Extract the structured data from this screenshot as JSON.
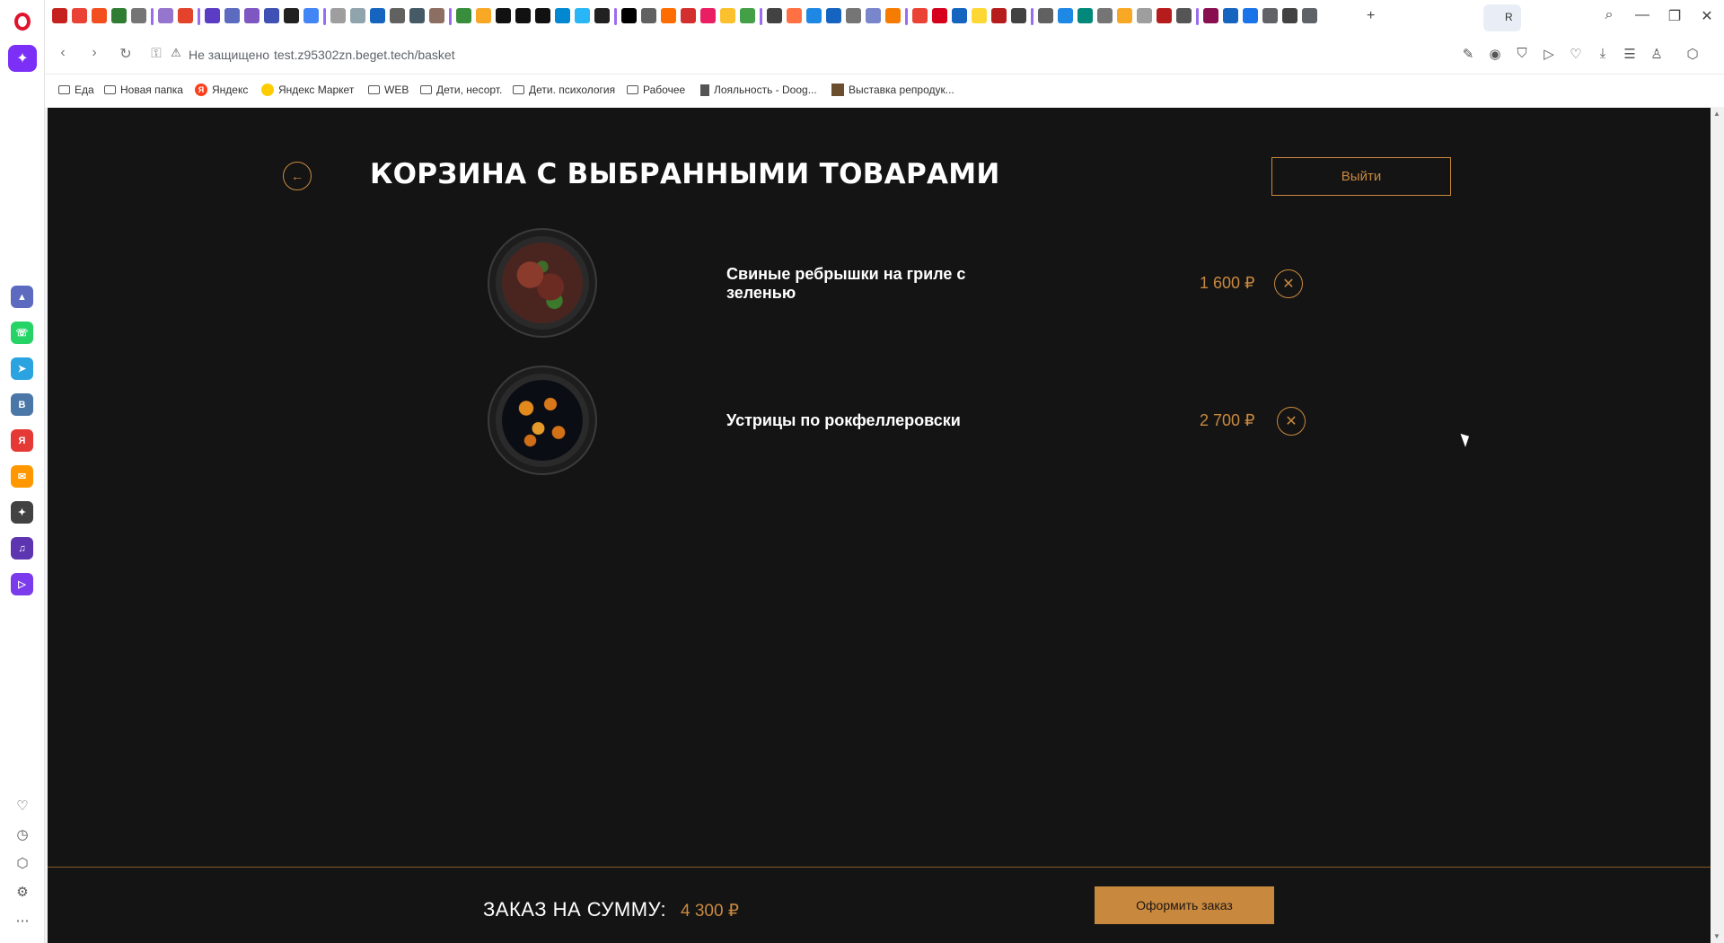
{
  "browser": {
    "tabs": {
      "favicon_colors": [
        "#c5221f",
        "#ea4335",
        "#f24e1e",
        "#2e7d32",
        "#757575",
        "#9575cd",
        "#e2432a",
        "#5b3cc4",
        "#5c6bc0",
        "#7e57c2",
        "#3f51b5",
        "#212121",
        "#4285f4",
        "#9e9e9e",
        "#90a4ae",
        "#1565c0",
        "#616161",
        "#455a64",
        "#8d6e63",
        "#388e3c",
        "#f9a825",
        "#111111",
        "#111111",
        "#111111",
        "#0288d1",
        "#29b6f6",
        "#212121",
        "#000000",
        "#616161",
        "#ff6d00",
        "#d32f2f",
        "#e91e63",
        "#fbc02d",
        "#43a047",
        "#424242",
        "#ff7043",
        "#1e88e5",
        "#1565c0",
        "#757575",
        "#7986cb",
        "#f57c00",
        "#ea4335",
        "#d6001c",
        "#1565c0",
        "#fdd835",
        "#b71c1c",
        "#424242",
        "#616161",
        "#1e88e5",
        "#00897b",
        "#757575",
        "#f9a825",
        "#9e9e9e",
        "#b71c1c",
        "#555555",
        "#880e4f",
        "#1565c0",
        "#1a73e8",
        "#5f6368",
        "#424242",
        "#5f6368"
      ],
      "active_tab_label": "R"
    },
    "window_controls": {
      "search": "⌕",
      "minimize": "—",
      "restore": "❐",
      "close": "✕"
    },
    "address_bar": {
      "back_icon": "‹",
      "forward_icon": "›",
      "reload_icon": "↻",
      "security_label": "Не защищено",
      "url": "test.z95302zn.beget.tech/basket"
    },
    "bookmarks": [
      {
        "label": "Еда",
        "icon": "folder"
      },
      {
        "label": "Новая папка",
        "icon": "folder"
      },
      {
        "label": "Яндекс",
        "icon": "yandex"
      },
      {
        "label": "Яндекс Маркет",
        "icon": "yandex-market"
      },
      {
        "label": "WEB",
        "icon": "folder"
      },
      {
        "label": "Дети, несорт.",
        "icon": "folder"
      },
      {
        "label": "Дети. психология",
        "icon": "folder"
      },
      {
        "label": "Рабочее",
        "icon": "folder"
      },
      {
        "label": "Лояльность - Doog...",
        "icon": "page"
      },
      {
        "label": "Выставка репродук...",
        "icon": "image"
      }
    ],
    "sidebar_apps": [
      {
        "name": "aria",
        "color": "#5c6bc0",
        "glyph": "▲"
      },
      {
        "name": "whatsapp",
        "color": "#25d366",
        "glyph": "☏"
      },
      {
        "name": "telegram",
        "color": "#2aa3e0",
        "glyph": "➤"
      },
      {
        "name": "vk",
        "color": "#4a76a8",
        "glyph": "В"
      },
      {
        "name": "yandex",
        "color": "#e53935",
        "glyph": "Я"
      },
      {
        "name": "mail",
        "color": "#ff9800",
        "glyph": "✉"
      },
      {
        "name": "app-grid",
        "color": "#424242",
        "glyph": "✦"
      },
      {
        "name": "music",
        "color": "#5e35b1",
        "glyph": "♫"
      },
      {
        "name": "player",
        "color": "#7c3aed",
        "glyph": "▷"
      }
    ]
  },
  "page": {
    "title": "КОРЗИНА С ВЫБРАННЫМИ ТОВАРАМИ",
    "back_icon": "←",
    "logout_label": "Выйти",
    "items": [
      {
        "name": "Свиные ребрышки на гриле с зеленью",
        "price": "1 600 ₽",
        "remove_icon": "✕"
      },
      {
        "name": "Устрицы по рокфеллеровски",
        "price": "2 700 ₽",
        "remove_icon": "✕"
      }
    ],
    "order_label": "ЗАКАЗ НА СУММУ:",
    "order_total": "4 300 ₽",
    "checkout_label": "Оформить заказ",
    "accent_color": "#c8893f",
    "background_color": "#151414"
  }
}
